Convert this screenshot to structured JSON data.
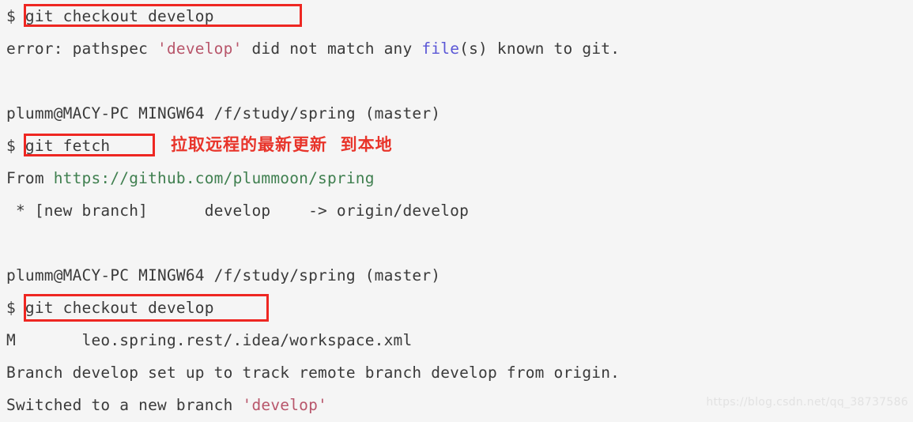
{
  "terminal": {
    "background_color": "#f5f5f5",
    "default_text_color": "#3a3a3a",
    "highlight_box_color": "#ee2722",
    "annotation_color": "#e8342a",
    "lines": [
      {
        "id": "cmd-checkout-1",
        "prompt": "$ ",
        "command": "git checkout develop"
      },
      {
        "id": "error-pathspec",
        "seg_a": "error: pathspec ",
        "seg_b": "'develop'",
        "seg_c": " did not match any ",
        "seg_d": "file",
        "seg_e": "(s) known to git."
      },
      {
        "id": "prompt-1",
        "text": "plumm@MACY-PC MINGW64 /f/study/spring (master)"
      },
      {
        "id": "cmd-fetch",
        "prompt": "$ ",
        "command": "git fetch",
        "annotation": "拉取远程的最新更新  到本地"
      },
      {
        "id": "from-remote",
        "seg_a": "From ",
        "seg_b": "https://github.com/plummoon/spring"
      },
      {
        "id": "new-branch",
        "text": " * [new branch]      develop    -> origin/develop"
      },
      {
        "id": "prompt-2",
        "text": "plumm@MACY-PC MINGW64 /f/study/spring (master)"
      },
      {
        "id": "cmd-checkout-2",
        "prompt": "$ ",
        "command": "git checkout develop"
      },
      {
        "id": "modified-file",
        "text": "M       leo.spring.rest/.idea/workspace.xml"
      },
      {
        "id": "branch-tracking",
        "text": "Branch develop set up to track remote branch develop from origin."
      },
      {
        "id": "switched-branch",
        "seg_a": "Switched to a new branch ",
        "seg_b": "'develop'"
      }
    ]
  },
  "watermark": {
    "text": "https://blog.csdn.net/qq_38737586"
  }
}
